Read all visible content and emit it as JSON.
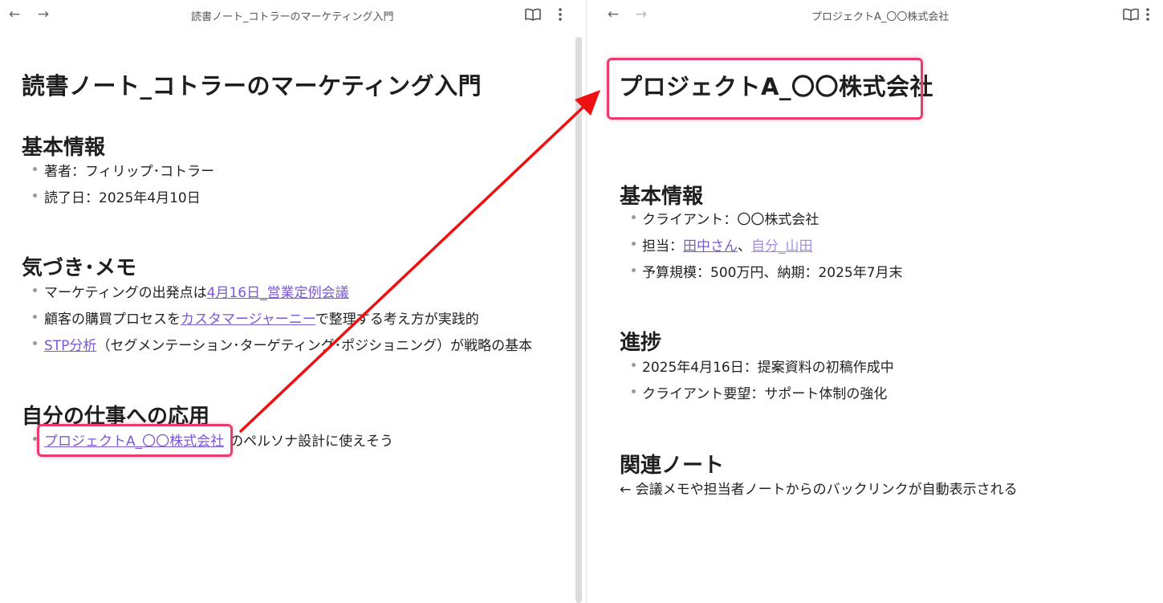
{
  "left_pane": {
    "tab_title": "読書ノート_コトラーのマーケティング入門",
    "title": "読書ノート_コトラーのマーケティング入門",
    "basic_heading": "基本情報",
    "basic_items": [
      "著者：フィリップ･コトラー",
      "読了日：2025年4月10日"
    ],
    "memo_heading": "気づき･メモ",
    "memo_1_prefix": "マーケティングの出発点は",
    "memo_1_link": "4月16日_営業定例会議",
    "memo_2_prefix": "顧客の購買プロセスを",
    "memo_2_link": "カスタマージャーニー",
    "memo_2_suffix": "で整理する考え方が実践的",
    "memo_3_link": "STP分析",
    "memo_3_suffix": "（セグメンテーション･ターゲティング･ポジショニング）が戦略の基本",
    "apply_heading": "自分の仕事への応用",
    "apply_link": "プロジェクトA_〇〇株式会社",
    "apply_suffix": "のペルソナ設計に使えそう"
  },
  "right_pane": {
    "tab_title": "プロジェクトA_〇〇株式会社",
    "title": "プロジェクトA_〇〇株式会社",
    "basic_heading": "基本情報",
    "client": "クライアント：〇〇株式会社",
    "owner_prefix": "担当：",
    "owner_link_1": "田中さん",
    "owner_sep": "、",
    "owner_link_2": "自分_山田",
    "budget": "予算規模：500万円、納期：2025年7月末",
    "progress_heading": "進捗",
    "progress_items": [
      "2025年4月16日：提案資料の初稿作成中",
      "クライアント要望：サポート体制の強化"
    ],
    "related_heading": "関連ノート",
    "related_text": "← 会議メモや担当者ノートからのバックリンクが自動表示される"
  },
  "icons": {
    "back": "arrow-left-icon",
    "forward": "arrow-right-icon",
    "reading_view": "book-open-icon",
    "more": "more-vertical-icon"
  },
  "colors": {
    "link": "#7b58d6",
    "link_light": "#a58be6",
    "highlight": "#ec3a6e",
    "arrow": "#ee1111"
  }
}
